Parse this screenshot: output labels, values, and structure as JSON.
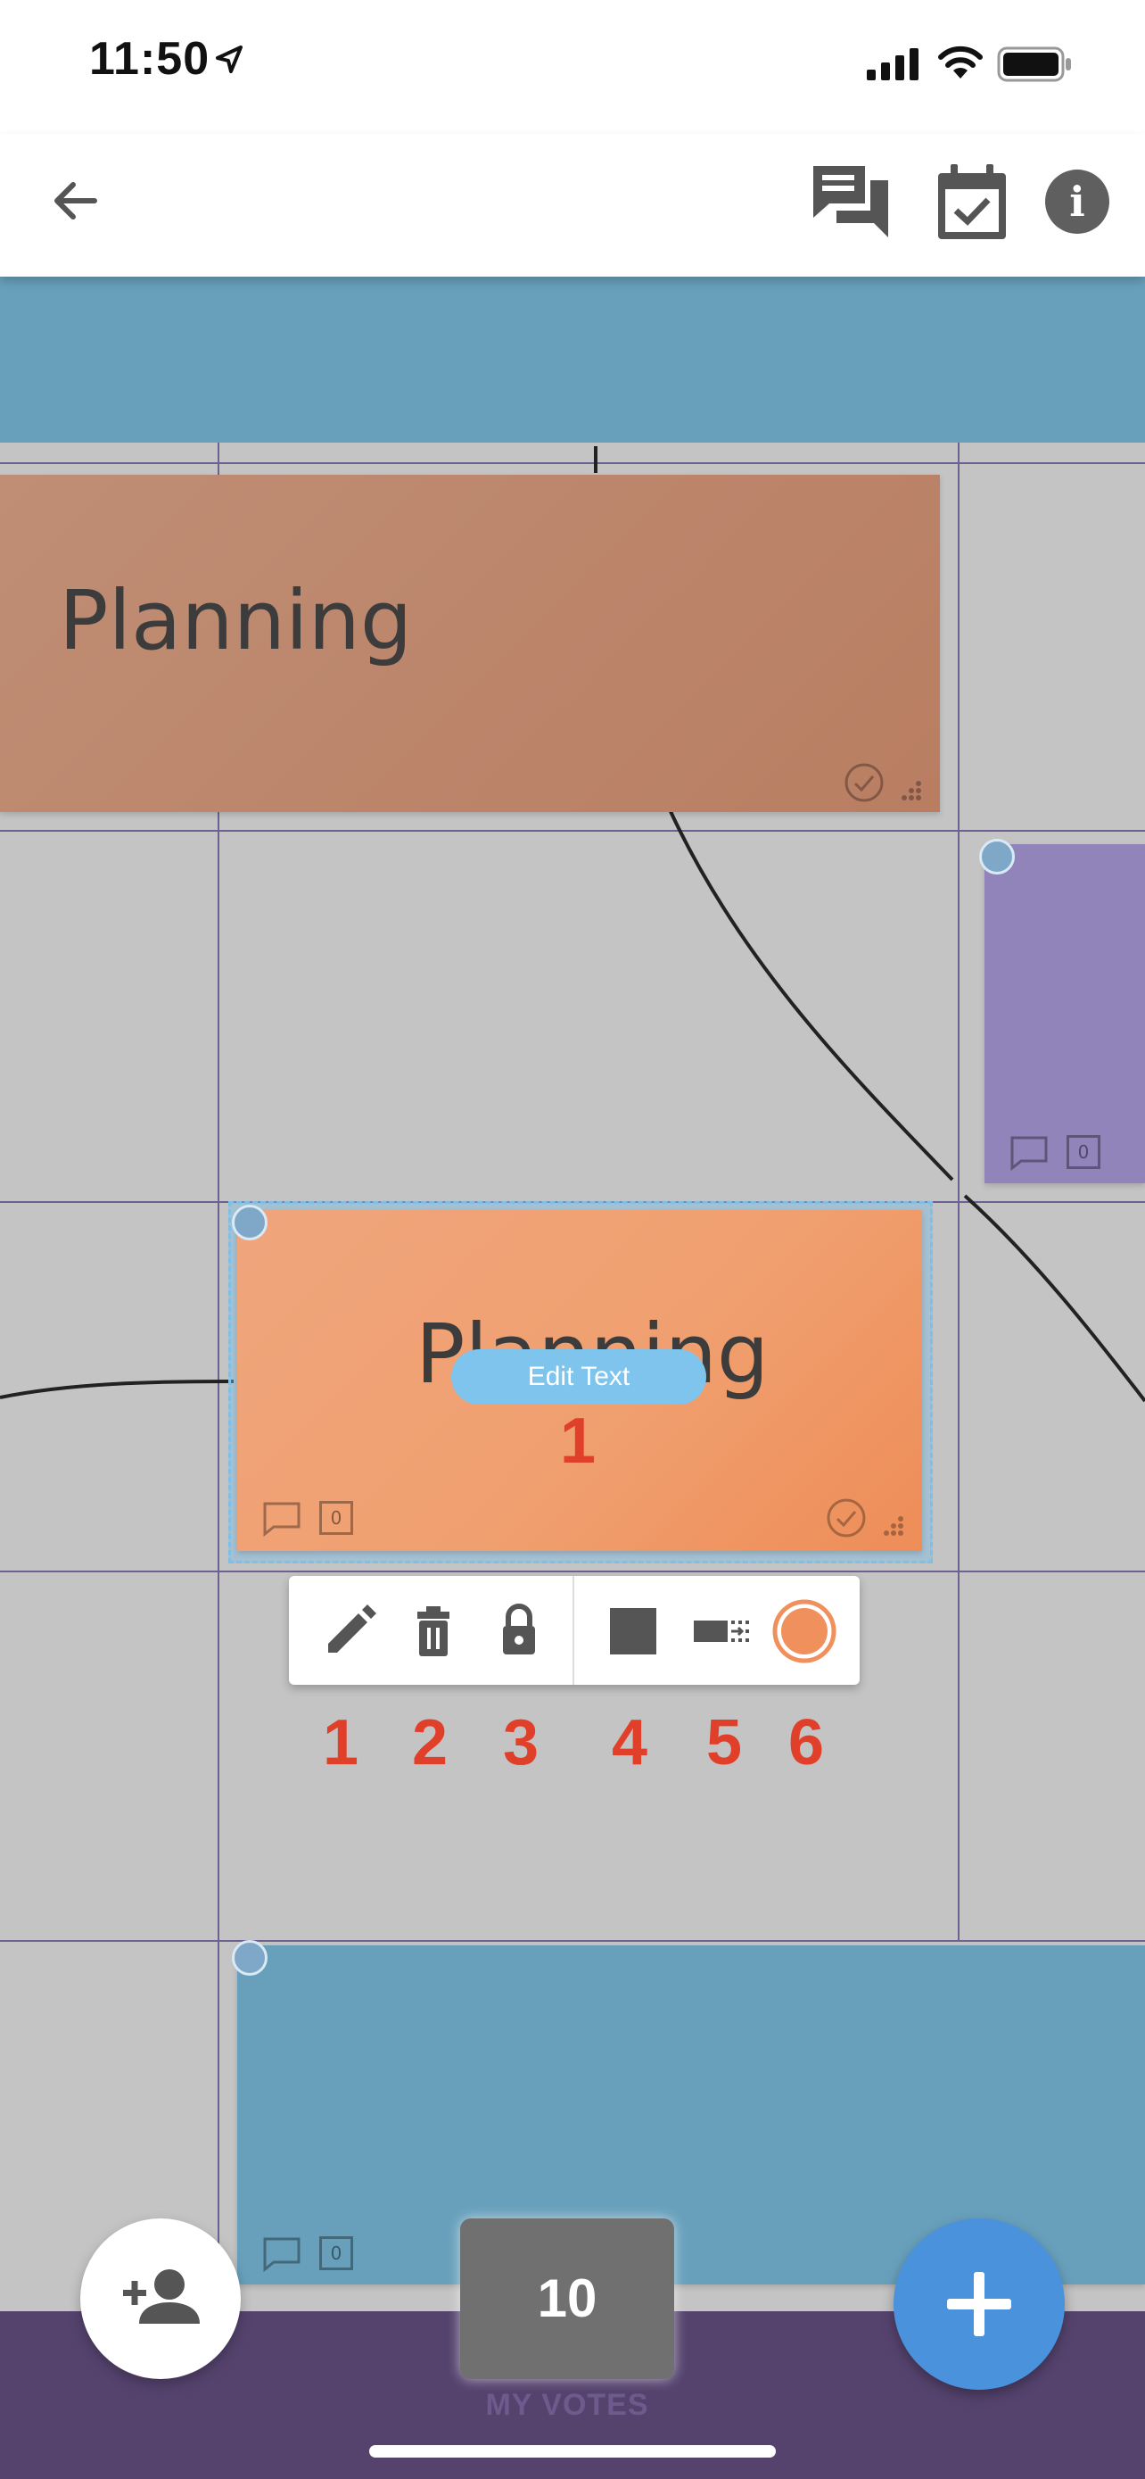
{
  "status_bar": {
    "time": "11:50"
  },
  "header": {
    "back": "back-arrow-icon",
    "chat": "chat-icon",
    "calendar": "calendar-check-icon",
    "info": "info-icon"
  },
  "board": {
    "top_note_text": "Planning",
    "selected_note": {
      "text": "Planning",
      "edit_button_label": "Edit Text",
      "comment_count": "0",
      "annotation": "1"
    },
    "purple_note": {
      "comment_count": "0"
    },
    "blue_note": {
      "comment_count": "0"
    }
  },
  "toolbar": {
    "tools": [
      "edit-pencil-icon",
      "delete-trash-icon",
      "lock-icon",
      "square-shape-icon",
      "resize-icon",
      "color-circle-icon"
    ],
    "annotations": [
      "1",
      "2",
      "3",
      "4",
      "5",
      "6"
    ],
    "selected_color": "#f0905c"
  },
  "bottom": {
    "votes": "10",
    "votes_label": "MY VOTES"
  },
  "colors": {
    "top_banner": "#68a0bc",
    "brown_note": "#bb8a70",
    "purple_note": "#9184ba",
    "orange_note": "#f0a070",
    "blue_note": "#68a0bc",
    "accent": "#4a93dc",
    "annotation_red": "#e0402a"
  }
}
